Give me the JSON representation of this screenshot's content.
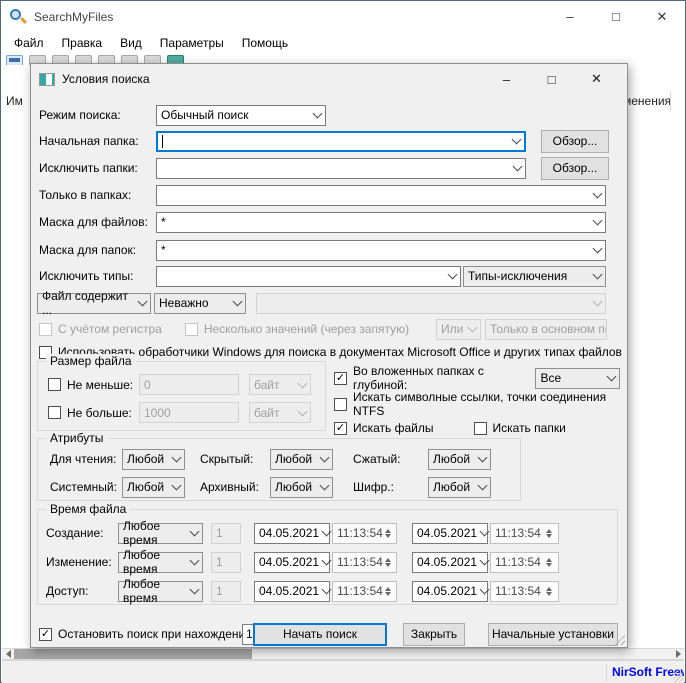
{
  "window": {
    "title": "SearchMyFiles",
    "menu": [
      "Файл",
      "Правка",
      "Вид",
      "Параметры",
      "Помощь"
    ],
    "minimize": "–",
    "maximize": "□",
    "close": "✕",
    "header_left_partial": "Им",
    "header_right_partial": "менения",
    "statusbar_link": "NirSoft Freew"
  },
  "dialog": {
    "title": "Условия поиска",
    "minimize": "–",
    "maximize": "□",
    "close": "✕",
    "mode": {
      "label": "Режим поиска:",
      "value": "Обычный поиск"
    },
    "base_folder": {
      "label": "Начальная папка:",
      "value": "",
      "browse": "Обзор..."
    },
    "exclude_folders": {
      "label": "Исключить папки:",
      "value": "",
      "browse": "Обзор..."
    },
    "only_folders": {
      "label": "Только в папках:",
      "value": ""
    },
    "files_mask": {
      "label": "Маска для файлов:",
      "value": "*"
    },
    "folders_mask": {
      "label": "Маска для папок:",
      "value": "*"
    },
    "exclude_types": {
      "label": "Исключить типы:",
      "value": "",
      "preset": "Типы-исключения"
    },
    "contains": {
      "mode": "Файл содержит ...",
      "match": "Неважно",
      "value": ""
    },
    "case_checkbox": {
      "label": "С учётом регистра",
      "checked": false
    },
    "multi_checkbox": {
      "label": "Несколько значений (через запятую)",
      "checked": false
    },
    "or_combo": "Или",
    "stream_combo": "Только в основном пото",
    "windows_checkbox": {
      "label": "Использовать обработчики Windows для поиска в документах Microsoft Office и других типах файлов",
      "checked": false
    },
    "size_group": {
      "title": "Размер файла",
      "min": {
        "label": "Не меньше:",
        "value": "0",
        "unit": "байт",
        "checked": false
      },
      "max": {
        "label": "Не больше:",
        "value": "1000",
        "unit": "байт",
        "checked": false
      }
    },
    "options": {
      "depth": {
        "label": "Во вложенных папках с глубиной:",
        "value": "Все",
        "checked": true
      },
      "symlinks": {
        "label": "Искать символные ссылки, точки соединения NTFS",
        "checked": false
      },
      "files": {
        "label": "Искать файлы",
        "checked": true
      },
      "folders": {
        "label": "Искать папки",
        "checked": false
      }
    },
    "attributes": {
      "title": "Атрибуты",
      "items": [
        {
          "label": "Для чтения:",
          "value": "Любой"
        },
        {
          "label": "Скрытый:",
          "value": "Любой"
        },
        {
          "label": "Сжатый:",
          "value": "Любой"
        },
        {
          "label": "Системный:",
          "value": "Любой"
        },
        {
          "label": "Архивный:",
          "value": "Любой"
        },
        {
          "label": "Шифр.:",
          "value": "Любой"
        }
      ]
    },
    "time_group": {
      "title": "Время файла",
      "rows": [
        {
          "label": "Создание:",
          "mode": "Любое время",
          "n": "1",
          "date1": "04.05.2021",
          "time1": "11:13:54",
          "date2": "04.05.2021",
          "time2": "11:13:54"
        },
        {
          "label": "Изменение:",
          "mode": "Любое время",
          "n": "1",
          "date1": "04.05.2021",
          "time1": "11:13:54",
          "date2": "04.05.2021",
          "time2": "11:13:54"
        },
        {
          "label": "Доступ:",
          "mode": "Любое время",
          "n": "1",
          "date1": "04.05.2021",
          "time1": "11:13:54",
          "date2": "04.05.2021",
          "time2": "11:13:54"
        }
      ]
    },
    "footer": {
      "stop": {
        "label": "Остановить поиск при нахождении",
        "value": "1",
        "checked": true
      },
      "start": "Начать поиск",
      "close": "Закрыть",
      "defaults": "Начальные установки"
    }
  }
}
